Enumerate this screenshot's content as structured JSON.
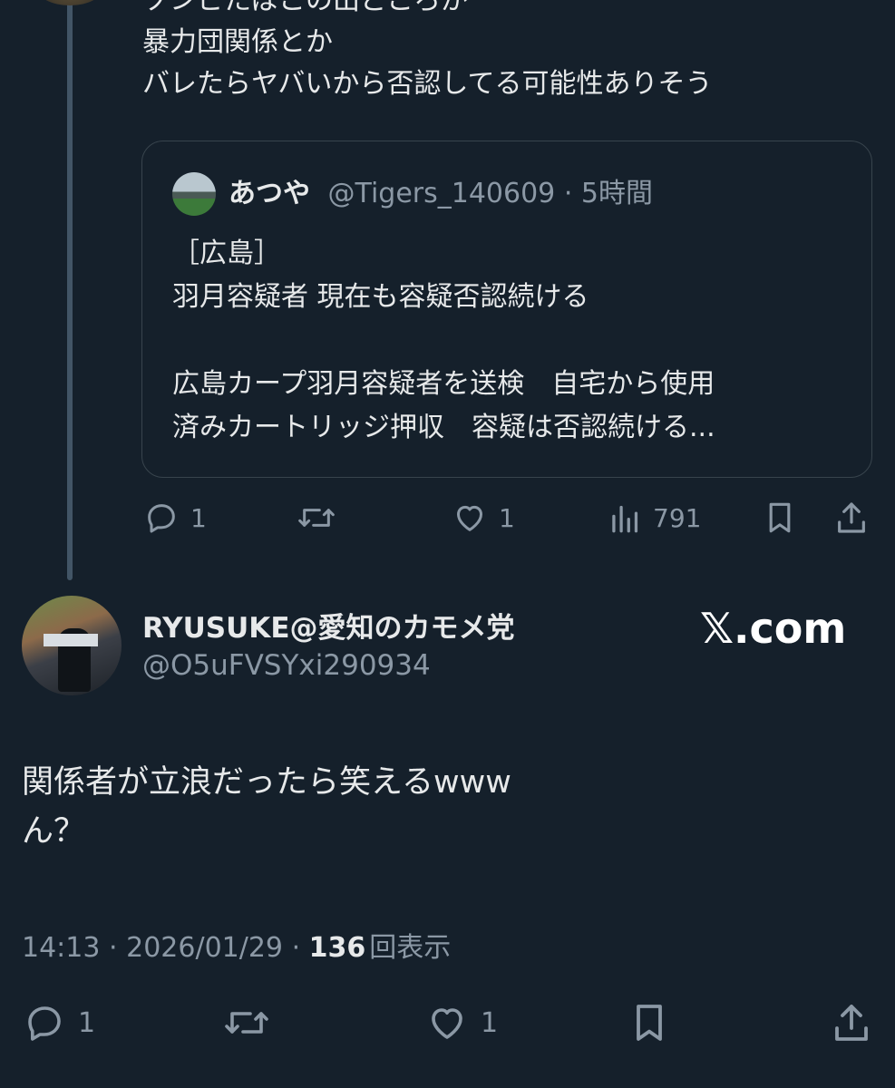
{
  "parent_tweet": {
    "lines": [
      "ゾンビたばこの出どころが",
      "暴力団関係とか",
      "バレたらヤバいから否認してる可能性ありそう"
    ]
  },
  "quoted_tweet": {
    "name": "あつや",
    "handle": "@Tigers_140609",
    "separator": "·",
    "time": "5時間",
    "body": "［広島］\n羽月容疑者 現在も容疑否認続ける\n\n広島カープ羽月容疑者を送検　自宅から使用\n済みカートリッジ押収　容疑は否認続ける..."
  },
  "parent_actions": {
    "replies": "1",
    "retweets": "",
    "likes": "1",
    "views": "791"
  },
  "main_tweet": {
    "author_name": "RYUSUKE@愛知のカモメ党",
    "author_handle": "@O5uFVSYxi290934",
    "text": "関係者が立浪だったら笑えるwww\nん？",
    "time": "14:13",
    "separator": "·",
    "date": "2026/01/29",
    "view_count": "136",
    "view_label": "回表示"
  },
  "main_actions": {
    "replies": "1",
    "retweets": "",
    "likes": "1"
  },
  "brand": {
    "label": "𝕏.com"
  },
  "colors": {
    "background": "#15202b",
    "text": "#e7e9ea",
    "muted": "#8b98a5",
    "border": "#38444d"
  },
  "icons": [
    "reply-icon",
    "retweet-icon",
    "like-icon",
    "views-icon",
    "bookmark-icon",
    "share-icon"
  ]
}
